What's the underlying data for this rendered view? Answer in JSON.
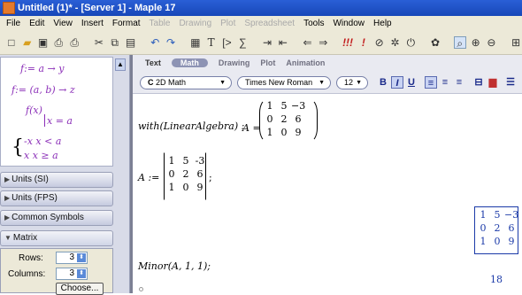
{
  "window": {
    "title": "Untitled (1)* - [Server 1] - Maple 17"
  },
  "menu": [
    "File",
    "Edit",
    "View",
    "Insert",
    "Format",
    "Table",
    "Drawing",
    "Plot",
    "Spreadsheet",
    "Tools",
    "Window",
    "Help"
  ],
  "menu_disabled": [
    "Table",
    "Drawing",
    "Plot",
    "Spreadsheet"
  ],
  "toolbar": {
    "icons": [
      "new-document-icon",
      "open-icon",
      "save-icon",
      "print-icon",
      "print-preview-icon",
      "cut-icon",
      "copy-icon",
      "paste-icon",
      "undo-icon",
      "redo-icon",
      "insert-text-icon",
      "text-mode-icon",
      "prompt-icon",
      "sum-icon",
      "indent-icon",
      "outdent-icon",
      "back-icon",
      "forward-icon",
      "execute-all-icon",
      "execute-icon",
      "stop-icon",
      "debug-icon",
      "restart-icon",
      "help-icon",
      "zoom-icon"
    ]
  },
  "palette": {
    "expr1": "f:= a → y",
    "expr2": "f:= (a, b) → z",
    "expr3_f": "f(x)",
    "expr3_cond": "x = a",
    "piece1": "-x  x < a",
    "piece2": "x  x ≥ a",
    "sections": [
      "Units (SI)",
      "Units (FPS)",
      "Common Symbols",
      "Matrix"
    ],
    "matrix": {
      "rows_label": "Rows:",
      "rows_value": "3",
      "cols_label": "Columns:",
      "cols_value": "3",
      "choose_label": "Choose..."
    }
  },
  "context_tabs": [
    "Text",
    "Math",
    "Drawing",
    "Plot",
    "Animation"
  ],
  "format": {
    "mode": "2D Math",
    "mode_prefix": "C",
    "font": "Times New Roman",
    "size": "12",
    "bold": "B",
    "italic": "I",
    "underline": "U"
  },
  "document": {
    "line1_cmd": "with(LinearAlgebra) :",
    "line1_lhs": "A =",
    "line1_matrix": [
      [
        "1",
        "5",
        "−3"
      ],
      [
        "0",
        "2",
        "6"
      ],
      [
        "1",
        "0",
        "9"
      ]
    ],
    "line2_lhs": "A :=",
    "line2_matrix": [
      [
        "1",
        "5",
        "-3"
      ],
      [
        "0",
        "2",
        "6"
      ],
      [
        "1",
        "0",
        "9"
      ]
    ],
    "line2_end": ";",
    "output_matrix": [
      [
        "1",
        "5",
        "−3"
      ],
      [
        "0",
        "2",
        "6"
      ],
      [
        "1",
        "0",
        "9"
      ]
    ],
    "minor_cmd": "Minor(A, 1, 1);",
    "minor_result": "18"
  }
}
